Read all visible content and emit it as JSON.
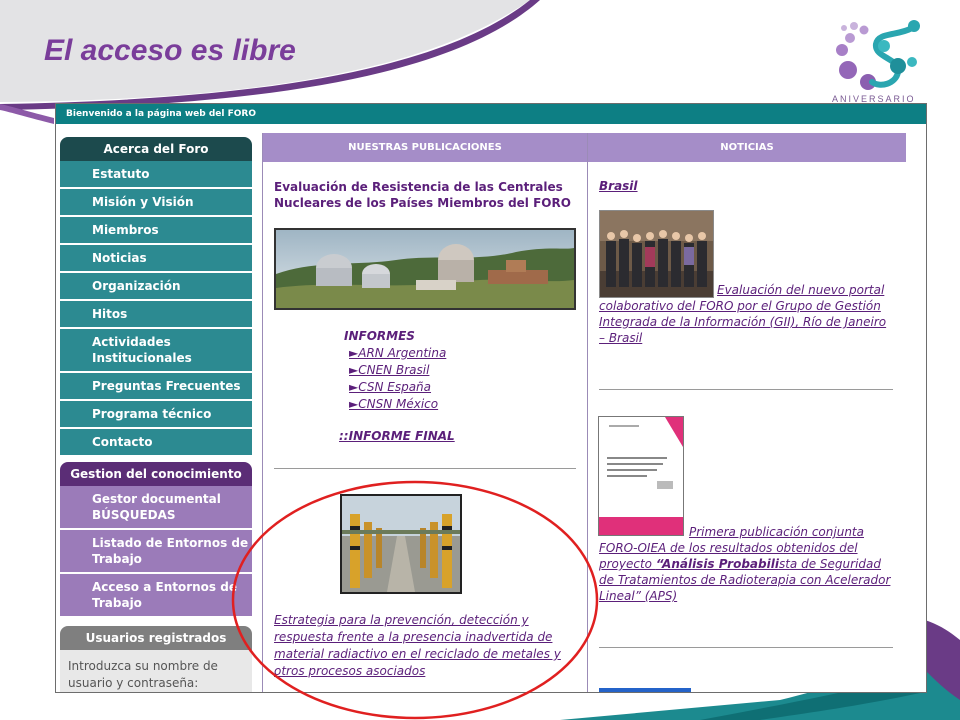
{
  "slide": {
    "title": "El acceso es libre",
    "logo_text": "ANIVERSARIO"
  },
  "site": {
    "welcome_bar": "Bienvenido a la página web del FORO",
    "menu_acerca": {
      "heading": "Acerca del Foro",
      "items": [
        "Estatuto",
        "Misión y Visión",
        "Miembros",
        "Noticias",
        "Organización",
        "Hitos",
        "Actividades Institucionales",
        "Preguntas Frecuentes",
        "Programa técnico",
        "Contacto"
      ]
    },
    "menu_gestion": {
      "heading": "Gestion del conocimiento",
      "items": [
        "Gestor documental BÚSQUEDAS",
        "Listado de Entornos de Trabajo",
        "Acceso a Entornos de Trabajo"
      ]
    },
    "menu_usuarios": {
      "heading": "Usuarios registrados",
      "prompt": "Introduzca su nombre de usuario y contraseña:"
    },
    "publicaciones": {
      "heading": "NUESTRAS PUBLICACIONES",
      "title": "Evaluación de Resistencia de las Centrales Nucleares de los Países Miembros del FORO",
      "informes_label": "INFORMES",
      "informes": [
        "►ARN Argentina",
        "►CNEN Brasil",
        "►CSN España",
        "►CNSN México"
      ],
      "informe_final": "::INFORME FINAL",
      "estrategia": "Estrategia para la prevención, detección y respuesta frente a la presencia inadvertida de material radiactivo en el reciclado de metales y otros procesos asociados"
    },
    "noticias": {
      "heading": "NOTICIAS",
      "country": "Brasil",
      "news1": "Evaluación del nuevo portal colaborativo del FORO por el Grupo de Gestión Integrada de la Información (GII), Río de Janeiro – Brasil",
      "news2_part1": "Primera publicación conjunta FORO-OIEA de los resultados obtenidos del proyecto ",
      "news2_bold": "“Análisis Probabili",
      "news2_part2": "sta de Seguridad de Tratamientos de Radioterapia con Acelerador Lineal” (APS)"
    }
  },
  "colors": {
    "teal_dark": "#1c4a4d",
    "teal": "#2c8a91",
    "purple_dark": "#5b2d76",
    "purple_light": "#9b7bb9",
    "column_header": "#a58dc8",
    "link_purple": "#5b1f7a",
    "highlight_ellipse": "#e02020",
    "slide_title": "#7a3d9a"
  }
}
